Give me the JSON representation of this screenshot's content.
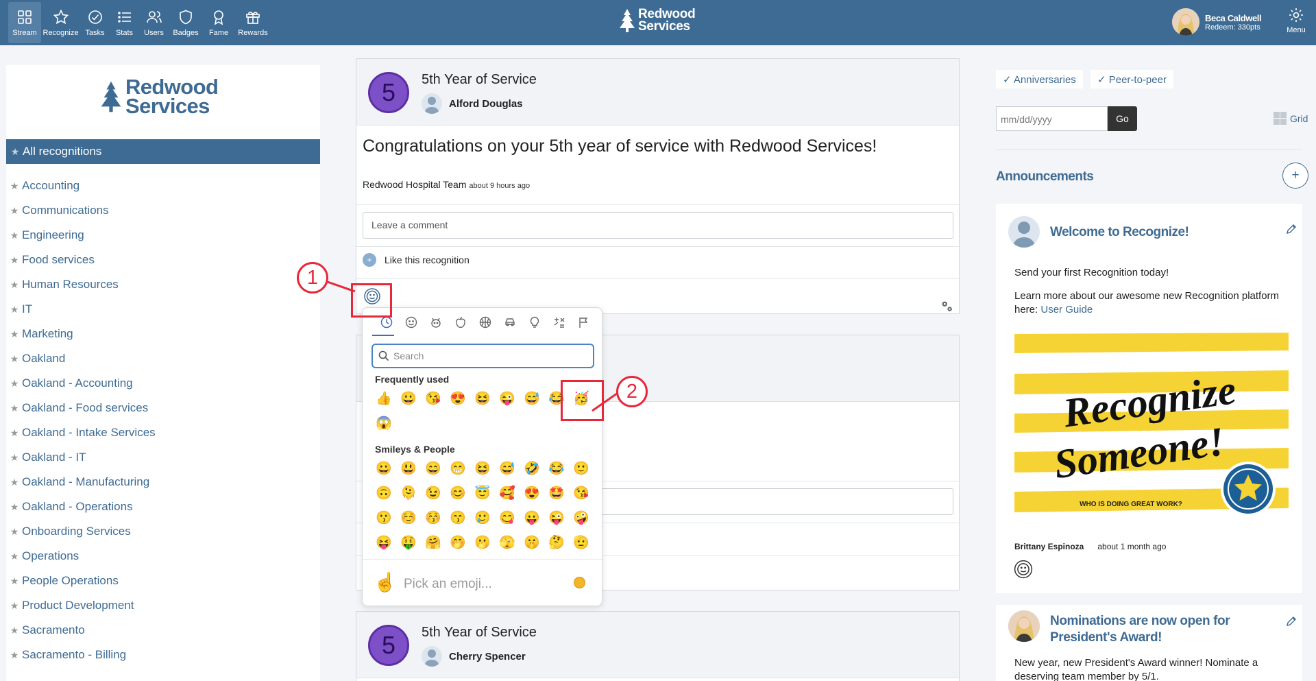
{
  "nav": {
    "items": [
      {
        "label": "Stream",
        "icon": "grid-icon",
        "active": true
      },
      {
        "label": "Recognize",
        "icon": "star-icon"
      },
      {
        "label": "Tasks",
        "icon": "check-circle-icon"
      },
      {
        "label": "Stats",
        "icon": "list-icon"
      },
      {
        "label": "Users",
        "icon": "users-icon"
      },
      {
        "label": "Badges",
        "icon": "shield-icon"
      },
      {
        "label": "Fame",
        "icon": "award-icon"
      },
      {
        "label": "Rewards",
        "icon": "gift-icon"
      }
    ],
    "brand_line1": "Redwood",
    "brand_line2": "Services",
    "user_name": "Beca Caldwell",
    "user_points": "Redeem: 330pts",
    "menu_label": "Menu"
  },
  "sidebar": {
    "logo_line1": "Redwood",
    "logo_line2": "Services",
    "all_label": "All recognitions",
    "categories": [
      "Accounting",
      "Communications",
      "Engineering",
      "Food services",
      "Human Resources",
      "IT",
      "Marketing",
      "Oakland",
      "Oakland - Accounting",
      "Oakland - Food services",
      "Oakland - Intake Services",
      "Oakland - IT",
      "Oakland - Manufacturing",
      "Oakland - Operations",
      "Onboarding Services",
      "Operations",
      "People Operations",
      "Product Development",
      "Sacramento",
      "Sacramento - Billing"
    ]
  },
  "feed": {
    "card1": {
      "badge_number": "5",
      "title": "5th Year of Service",
      "recipient": "Alford Douglas",
      "message": "Congratulations on your 5th year of service with Redwood Services!",
      "sender": "Redwood Hospital Team",
      "time": "about 9 hours ago",
      "comment_placeholder": "Leave a comment",
      "like_label": "Like this recognition"
    },
    "card3": {
      "badge_number": "5",
      "title": "5th Year of Service",
      "recipient": "Cherry Spencer"
    }
  },
  "emoji_picker": {
    "search_placeholder": "Search",
    "frequent_title": "Frequently used",
    "frequent": [
      "👍",
      "😀",
      "😘",
      "😍",
      "😆",
      "😜",
      "😅",
      "😂",
      "🥳",
      "😱"
    ],
    "smileys_title": "Smileys & People",
    "smileys": [
      "😀",
      "😃",
      "😄",
      "😁",
      "😆",
      "😅",
      "🤣",
      "😂",
      "🙂",
      "🙃",
      "🫠",
      "😉",
      "😊",
      "😇",
      "🥰",
      "😍",
      "🤩",
      "😘",
      "😗",
      "☺️",
      "😚",
      "😙",
      "🥲",
      "😋",
      "😛",
      "😜",
      "🤪",
      "😝",
      "🤑",
      "🤗",
      "🤭",
      "🫢",
      "🫣",
      "🤫",
      "🤔",
      "🫡"
    ],
    "footer_emoji": "☝️",
    "footer_text": "Pick an emoji...",
    "categories": [
      "clock-icon",
      "smiley-icon",
      "animal-icon",
      "food-icon",
      "activity-icon",
      "travel-icon",
      "objects-icon",
      "symbols-icon",
      "flags-icon"
    ]
  },
  "annotations": {
    "callout1": "1",
    "callout2": "2"
  },
  "right": {
    "filter1": "✓ Anniversaries",
    "filter2": "✓ Peer-to-peer",
    "date_placeholder": "mm/dd/yyyy",
    "go_label": "Go",
    "grid_label": "Grid",
    "announcements_title": "Announcements",
    "add_label": "+",
    "ann1": {
      "title": "Welcome to Recognize!",
      "line1": "Send your first Recognition today!",
      "line2": "Learn more about our awesome new Recognition platform here:",
      "link": "User Guide",
      "banner_text1": "Recognize",
      "banner_text2": "Someone!",
      "banner_sub": "WHO IS DOING GREAT WORK?",
      "author": "Brittany Espinoza",
      "time": "about 1 month ago"
    },
    "ann2": {
      "title": "Nominations are now open for President's Award!",
      "body": "New year, new President's Award winner! Nominate a deserving team member by 5/1."
    }
  },
  "colors": {
    "primary": "#3e6b93",
    "callout": "#e8283a",
    "badge": "#7d50c7",
    "banner_yellow": "#f6d335"
  }
}
